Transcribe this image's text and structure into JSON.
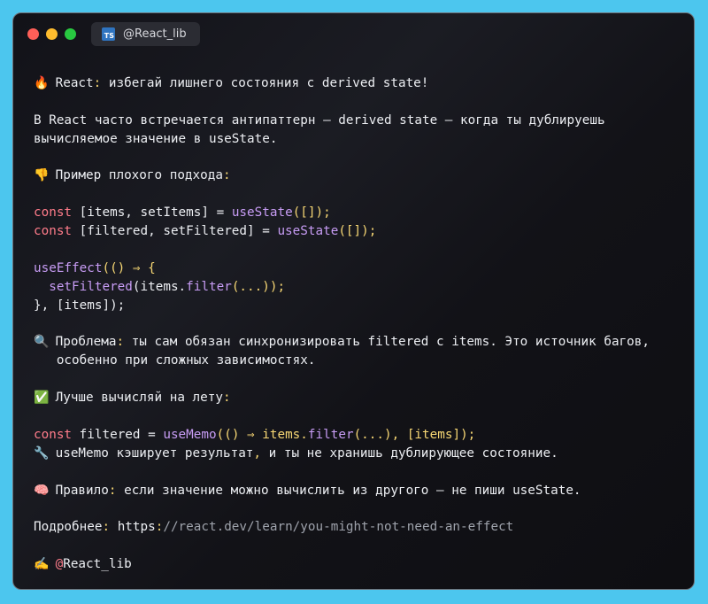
{
  "window": {
    "tab_label": "@React_lib",
    "tab_icon": "typescript-file-icon"
  },
  "post": {
    "title_emoji": "🔥",
    "title_a": "React",
    "title_b": ":",
    "title_c": " избегай лишнего состояния с derived state!",
    "intro_1": "В React часто встречается антипаттерн — derived state — когда ты дублируешь",
    "intro_2": "вычисляемое значение в useState.",
    "bad_emoji": "👎",
    "bad_heading": "Пример плохого подхода",
    "code": {
      "kw_const": "const",
      "items_decl": " [items, setItems] = ",
      "filtered_decl": " [filtered, setFiltered] = ",
      "use_state": "useState",
      "empty_array": "([]);",
      "use_effect": "useEffect",
      "effect_open": "(() ⇒ {",
      "set_filtered": "setFiltered",
      "set_filtered_args_a": "(items.",
      "filter": "filter",
      "set_filtered_args_b": "(...));",
      "effect_close": "}, [items]);",
      "memo_a": " filtered = ",
      "use_memo": "useMemo",
      "memo_b": "(() ⇒ items.",
      "memo_c": "(...), [items]);"
    },
    "problem_emoji": "🔍",
    "problem_label": "Проблема",
    "problem_text_1": " ты сам обязан синхронизировать filtered с items. Это источник багов,",
    "problem_text_2": "   особенно при сложных зависимостях.",
    "good_emoji": "✅",
    "good_heading": "Лучше вычисляй на лету",
    "memo_note_emoji": "🔧",
    "memo_note_a": "useMemo кэширует результат",
    "memo_note_b": " и ты не хранишь дублирующее состояние.",
    "rule_emoji": "🧠",
    "rule_label": "Правило",
    "rule_text": " если значение можно вычислить из другого — не пиши useState.",
    "more_label": "Подробнее",
    "more_proto": "https",
    "more_url": "//react.dev/learn/you-might-not-need-an-effect",
    "sign_emoji": "✍️",
    "sign_handle": "@React_lib"
  }
}
